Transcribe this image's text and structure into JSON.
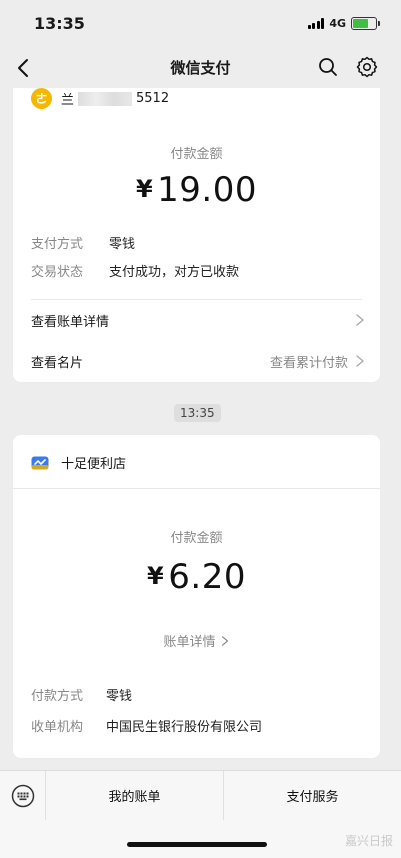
{
  "status_bar": {
    "time": "13:35",
    "network": "4G"
  },
  "nav": {
    "title": "微信支付"
  },
  "receipt1": {
    "avatar_char": "ㄜ",
    "merchant_prefix": "兰",
    "merchant_suffix": "5512",
    "amount_label": "付款金额",
    "currency": "¥",
    "amount": "19.00",
    "rows": [
      {
        "label": "支付方式",
        "value": "零钱"
      },
      {
        "label": "交易状态",
        "value": "支付成功，对方已收款"
      }
    ],
    "bill_details_link": "查看账单详情",
    "contact_card_link": "查看名片",
    "cumulative_link": "查看累计付款"
  },
  "timestamp": "13:35",
  "receipt2": {
    "store_name": "十足便利店",
    "amount_label": "付款金额",
    "currency": "¥",
    "amount": "6.20",
    "bill_detail_link": "账单详情",
    "rows": [
      {
        "label": "付款方式",
        "value": "零钱"
      },
      {
        "label": "收单机构",
        "value": "中国民生银行股份有限公司"
      }
    ]
  },
  "toolbar": {
    "my_bills": "我的账单",
    "pay_services": "支付服务"
  },
  "watermark": "嘉兴日报"
}
